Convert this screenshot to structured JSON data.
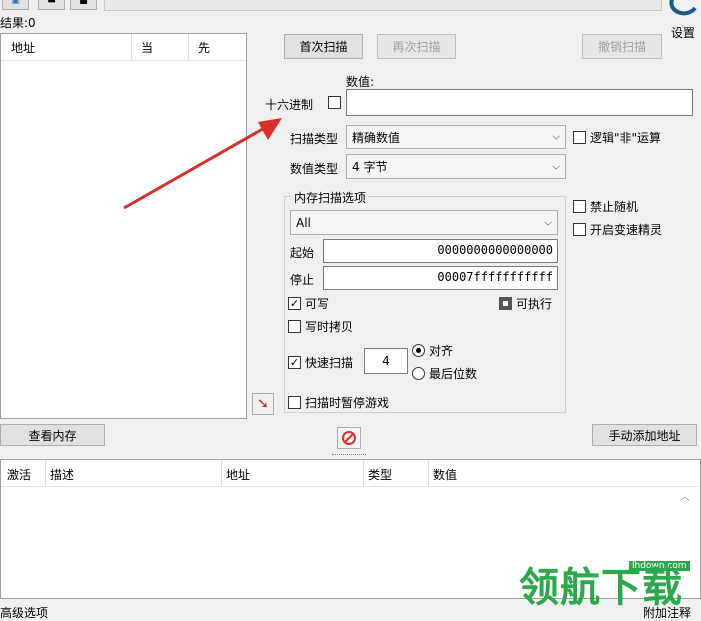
{
  "found": {
    "label": "结果:0"
  },
  "results_table": {
    "columns": [
      "地址",
      "当",
      "先"
    ]
  },
  "scan": {
    "first_scan": "首次扫描",
    "next_scan": "再次扫描",
    "undo_scan": "撤销扫描",
    "value_label": "数值:",
    "hex_label": "十六进制",
    "value_input": "",
    "scan_type_label": "扫描类型",
    "scan_type_value": "精确数值",
    "value_type_label": "数值类型",
    "value_type_value": "4 字节",
    "not_label": "逻辑\"非\"运算",
    "memory_options_title": "内存扫描选项",
    "region_value": "All",
    "start_label": "起始",
    "start_value": "0000000000000000",
    "stop_label": "停止",
    "stop_value": "00007fffffffffff",
    "writable_label": "可写",
    "executable_label": "可执行",
    "copy_on_write_label": "写时拷贝",
    "fast_scan_label": "快速扫描",
    "fast_scan_value": "4",
    "align_label": "对齐",
    "last_digits_label": "最后位数",
    "pause_game_label": "扫描时暂停游戏",
    "disable_random_label": "禁止随机",
    "speedhack_label": "开启变速精灵"
  },
  "settings": {
    "label": "设置"
  },
  "bottom_bar": {
    "view_memory": "查看内存",
    "add_address": "手动添加地址"
  },
  "address_list": {
    "columns": [
      "激活",
      "描述",
      "地址",
      "类型",
      "数值"
    ]
  },
  "footer": {
    "advanced": "高级选项",
    "attach": "附加注释"
  },
  "watermark": {
    "text": "领航下载",
    "url": "lhdown.com"
  },
  "colors": {
    "arrow": "#d9302a",
    "watermark_green": "#2aa84a",
    "stop_red": "#d9302a"
  }
}
